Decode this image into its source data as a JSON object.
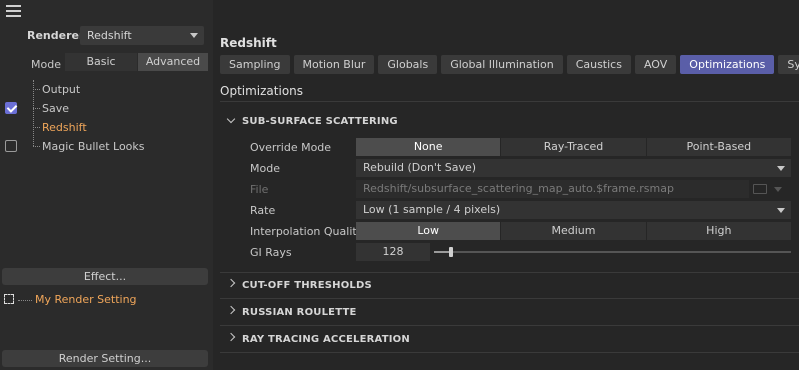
{
  "left_panel": {
    "renderer_label": "Renderer",
    "renderer_value": "Redshift",
    "mode_label": "Mode",
    "mode_options": [
      "Basic",
      "Advanced"
    ],
    "mode_selected": "Advanced",
    "tree": [
      {
        "label": "Output",
        "checkbox": false,
        "checked": false,
        "active": false
      },
      {
        "label": "Save",
        "checkbox": true,
        "checked": true,
        "active": false
      },
      {
        "label": "Redshift",
        "checkbox": false,
        "checked": false,
        "active": true
      },
      {
        "label": "Magic Bullet Looks",
        "checkbox": true,
        "checked": false,
        "active": false
      }
    ],
    "effect_button": "Effect...",
    "render_setting_name": "My Render Setting",
    "render_setting_button": "Render Setting..."
  },
  "right_panel": {
    "title": "Redshift",
    "tabs": [
      "Sampling",
      "Motion Blur",
      "Globals",
      "Global Illumination",
      "Caustics",
      "AOV",
      "Optimizations",
      "System"
    ],
    "active_tab": "Optimizations",
    "section_title": "Optimizations",
    "sss_group": {
      "title": "SUB-SURFACE SCATTERING",
      "override_mode_label": "Override Mode",
      "override_mode_options": [
        "None",
        "Ray-Traced",
        "Point-Based"
      ],
      "override_mode_selected": "None",
      "mode_label": "Mode",
      "mode_value": "Rebuild (Don't Save)",
      "file_label": "File",
      "file_value": "Redshift/subsurface_scattering_map_auto.$frame.rsmap",
      "rate_label": "Rate",
      "rate_value": "Low (1 sample / 4 pixels)",
      "interp_label": "Interpolation Quality",
      "interp_options": [
        "Low",
        "Medium",
        "High"
      ],
      "interp_selected": "Low",
      "gi_rays_label": "GI Rays",
      "gi_rays_value": "128",
      "gi_rays_slider_fraction": 0.02
    },
    "collapsed_groups": [
      "CUT-OFF THRESHOLDS",
      "RUSSIAN ROULETTE",
      "RAY TRACING ACCELERATION"
    ]
  },
  "colors": {
    "accent": "#5a5ea8",
    "active_item": "#f0a65a",
    "checkbox_on": "#6b6fd6"
  }
}
